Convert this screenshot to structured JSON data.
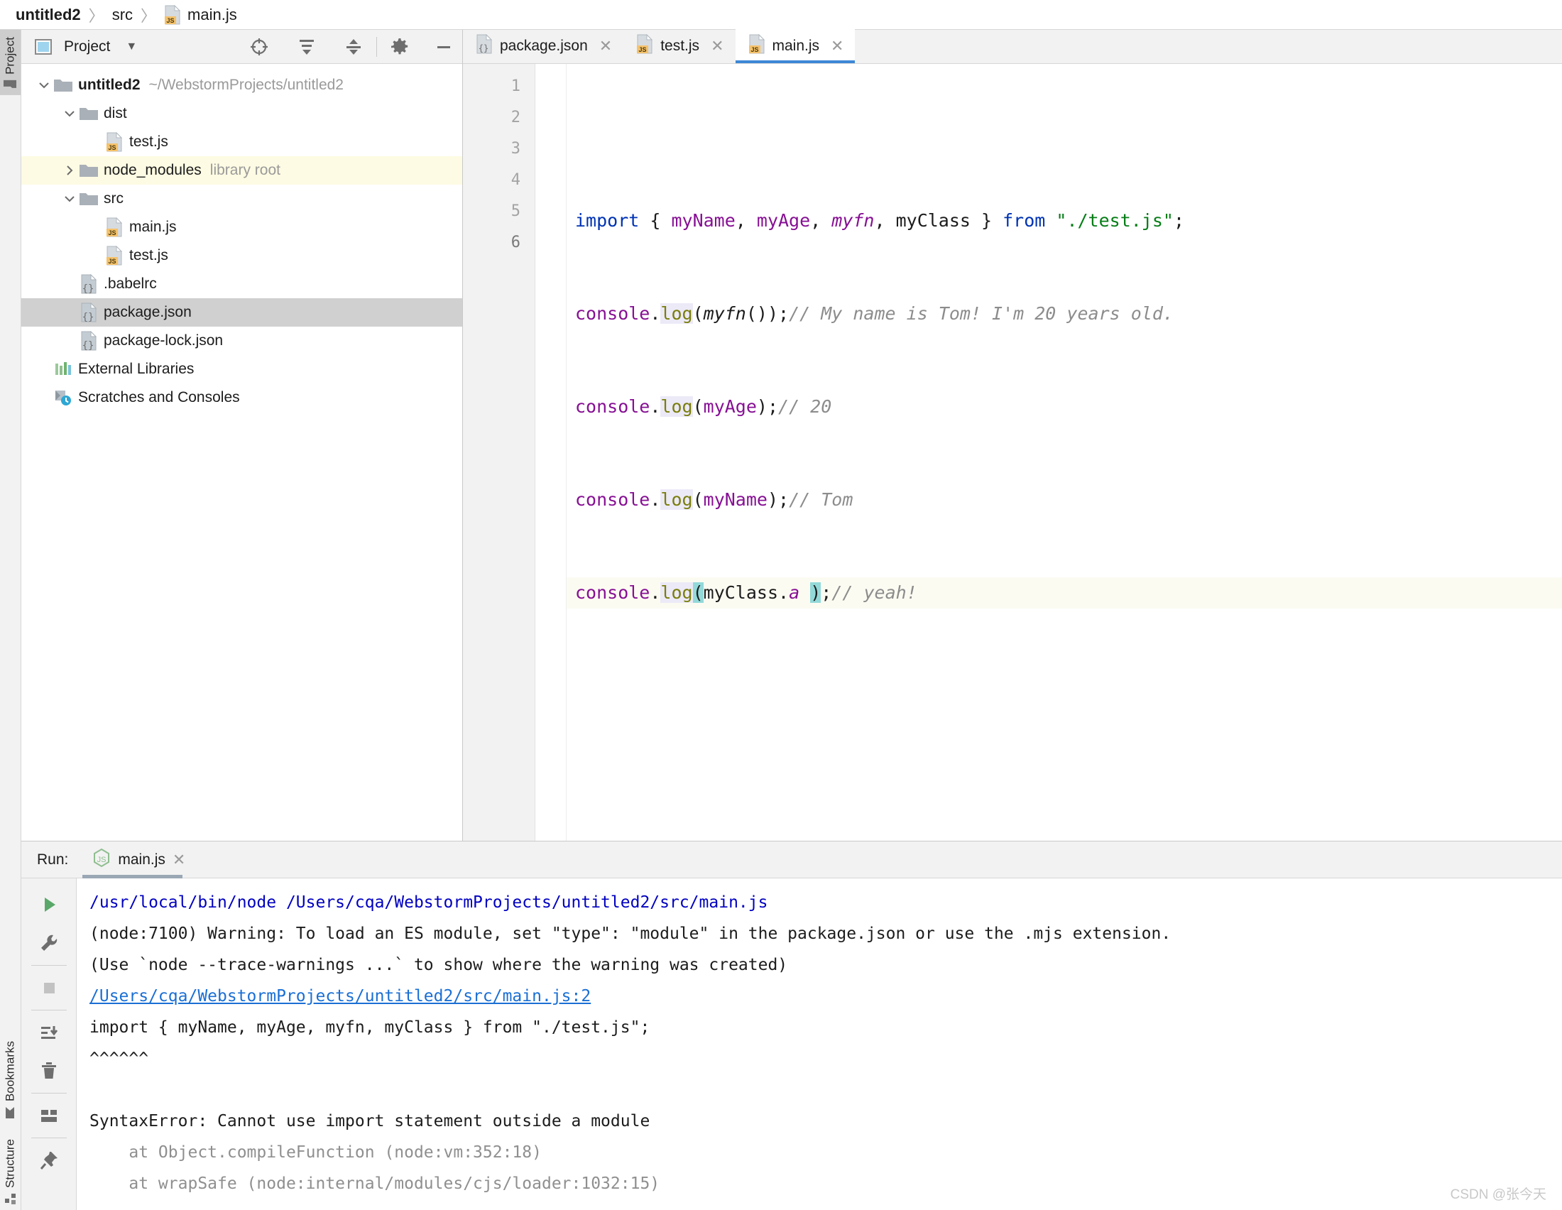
{
  "breadcrumb": {
    "items": [
      {
        "label": "untitled2",
        "icon": null,
        "bold": true
      },
      {
        "label": "src",
        "icon": null,
        "bold": false
      },
      {
        "label": "main.js",
        "icon": "js-file-icon",
        "bold": false
      }
    ],
    "separator": "〉"
  },
  "left_strip": {
    "top_tabs": [
      {
        "label": "Project",
        "icon": "folder-icon",
        "active": true
      }
    ],
    "bottom_tabs": [
      {
        "label": "Structure",
        "icon": "structure-icon",
        "active": false
      },
      {
        "label": "Bookmarks",
        "icon": "bookmark-icon",
        "active": false
      }
    ]
  },
  "project_panel": {
    "title": "Project",
    "dropdown_arrow": "▼",
    "icons": [
      {
        "name": "select-opened-file-icon"
      },
      {
        "name": "expand-all-icon"
      },
      {
        "name": "collapse-all-icon"
      },
      {
        "name": "settings-gear-icon"
      },
      {
        "name": "hide-panel-icon"
      }
    ],
    "tree": [
      {
        "depth": 0,
        "twisty": "down",
        "icon": "folder-icon",
        "label": "untitled2",
        "bold": true,
        "sub": "~/WebstormProjects/untitled2",
        "state": "normal"
      },
      {
        "depth": 1,
        "twisty": "down",
        "icon": "folder-icon",
        "label": "dist",
        "bold": false,
        "sub": "",
        "state": "normal"
      },
      {
        "depth": 2,
        "twisty": "none",
        "icon": "js-file-icon",
        "label": "test.js",
        "bold": false,
        "sub": "",
        "state": "normal"
      },
      {
        "depth": 1,
        "twisty": "right",
        "icon": "folder-icon",
        "label": "node_modules",
        "bold": false,
        "sub": "library root",
        "state": "highlight"
      },
      {
        "depth": 1,
        "twisty": "down",
        "icon": "folder-icon",
        "label": "src",
        "bold": false,
        "sub": "",
        "state": "normal"
      },
      {
        "depth": 2,
        "twisty": "none",
        "icon": "js-file-icon",
        "label": "main.js",
        "bold": false,
        "sub": "",
        "state": "normal"
      },
      {
        "depth": 2,
        "twisty": "none",
        "icon": "js-file-icon",
        "label": "test.js",
        "bold": false,
        "sub": "",
        "state": "normal"
      },
      {
        "depth": 1,
        "twisty": "none",
        "icon": "json-file-icon",
        "label": ".babelrc",
        "bold": false,
        "sub": "",
        "state": "normal"
      },
      {
        "depth": 1,
        "twisty": "none",
        "icon": "json-file-icon",
        "label": "package.json",
        "bold": false,
        "sub": "",
        "state": "selected"
      },
      {
        "depth": 1,
        "twisty": "none",
        "icon": "json-file-icon",
        "label": "package-lock.json",
        "bold": false,
        "sub": "",
        "state": "normal"
      },
      {
        "depth": 0,
        "twisty": "none",
        "icon": "external-libraries-icon",
        "label": "External Libraries",
        "bold": false,
        "sub": "",
        "state": "normal"
      },
      {
        "depth": 0,
        "twisty": "none",
        "icon": "scratches-icon",
        "label": "Scratches and Consoles",
        "bold": false,
        "sub": "",
        "state": "normal"
      }
    ]
  },
  "editor": {
    "tabs": [
      {
        "label": "package.json",
        "icon": "json-file-icon",
        "active": false,
        "close": "✕"
      },
      {
        "label": "test.js",
        "icon": "js-file-icon",
        "active": false,
        "close": "✕"
      },
      {
        "label": "main.js",
        "icon": "js-file-icon",
        "active": true,
        "close": "✕"
      }
    ],
    "line_numbers": [
      "1",
      "2",
      "3",
      "4",
      "5",
      "6"
    ],
    "current_line": 6,
    "lines": [
      {
        "num": 1,
        "text": ""
      },
      {
        "num": 2,
        "text": "import { myName, myAge, myfn, myClass } from \"./test.js\";"
      },
      {
        "num": 3,
        "text": "console.log(myfn());// My name is Tom! I'm 20 years old."
      },
      {
        "num": 4,
        "text": "console.log(myAge);// 20"
      },
      {
        "num": 5,
        "text": "console.log(myName);// Tom"
      },
      {
        "num": 6,
        "text": "console.log(myClass.a );// yeah!"
      }
    ]
  },
  "run_panel": {
    "label": "Run:",
    "tab": {
      "label": "main.js",
      "icon": "nodejs-icon",
      "close": "✕"
    },
    "toolbar": [
      {
        "name": "rerun-icon"
      },
      {
        "name": "edit-configuration-wrench-icon"
      },
      {
        "name": "stop-icon"
      },
      {
        "name": "scroll-to-end-icon"
      },
      {
        "name": "clear-all-trash-icon"
      },
      {
        "name": "layout-settings-icon"
      },
      {
        "name": "pin-tab-icon"
      }
    ],
    "console_lines": [
      {
        "type": "cmd",
        "text": "/usr/local/bin/node /Users/cqa/WebstormProjects/untitled2/src/main.js"
      },
      {
        "type": "err",
        "text": "(node:7100) Warning: To load an ES module, set \"type\": \"module\" in the package.json or use the .mjs extension."
      },
      {
        "type": "err",
        "text": "(Use `node --trace-warnings ...` to show where the warning was created)"
      },
      {
        "type": "link",
        "text": "/Users/cqa/WebstormProjects/untitled2/src/main.js:2"
      },
      {
        "type": "err",
        "text": "import { myName, myAge, myfn, myClass } from \"./test.js\";"
      },
      {
        "type": "err",
        "text": "^^^^^^"
      },
      {
        "type": "err",
        "text": ""
      },
      {
        "type": "err",
        "text": "SyntaxError: Cannot use import statement outside a module"
      },
      {
        "type": "dim",
        "text": "    at Object.compileFunction (node:vm:352:18)"
      },
      {
        "type": "dim",
        "text": "    at wrapSafe (node:internal/modules/cjs/loader:1032:15)"
      }
    ]
  },
  "watermark": "CSDN @张今天",
  "colors": {
    "accent": "#3d87d6",
    "js_badge": "#f5c26b",
    "keyword": "#0033b3",
    "string": "#067d17",
    "property": "#871094",
    "function": "#7a7e0b",
    "comment": "#8c8c8c",
    "selection_highlight": "#fdfbe3",
    "paren_match": "#93d9d9",
    "console_cmd": "#0000c0",
    "console_link": "#1a6fd4"
  }
}
